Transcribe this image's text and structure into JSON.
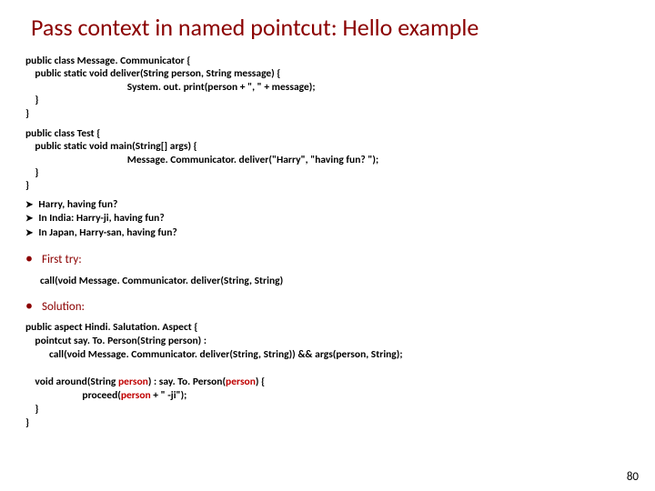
{
  "title": "Pass context in named pointcut: Hello example",
  "code1": "public class Message. Communicator {\n    public static void deliver(String person, String message) {\n                                           System. out. print(person + \", \" + message);\n    }\n}",
  "code2": "public class Test {\n    public static void main(String[] args) {\n                                           Message. Communicator. deliver(\"Harry\", \"having fun? \");\n    }\n}",
  "outputs": [
    "Harry, having fun?",
    "In India:  Harry-ji, having fun?",
    "In Japan, Harry-san, having fun?"
  ],
  "first_try_label": "First try:",
  "first_try_code": "call(void Message. Communicator. deliver(String, String)",
  "solution_label": "Solution:",
  "aspect_prefix": "public aspect Hindi. Salutation. Aspect {\n    pointcut say. To. Person(String person) :\n          call(void Message. Communicator. deliver(String, String)) && args(person, String);\n\n    void around(String ",
  "aspect_person1": "person",
  "aspect_mid1": ") : say. To. Person(",
  "aspect_person2": "person",
  "aspect_mid2": ") {\n                        proceed(",
  "aspect_person3": "person",
  "aspect_suffix": " + \" -ji\");\n    }\n}",
  "page_num": "80"
}
